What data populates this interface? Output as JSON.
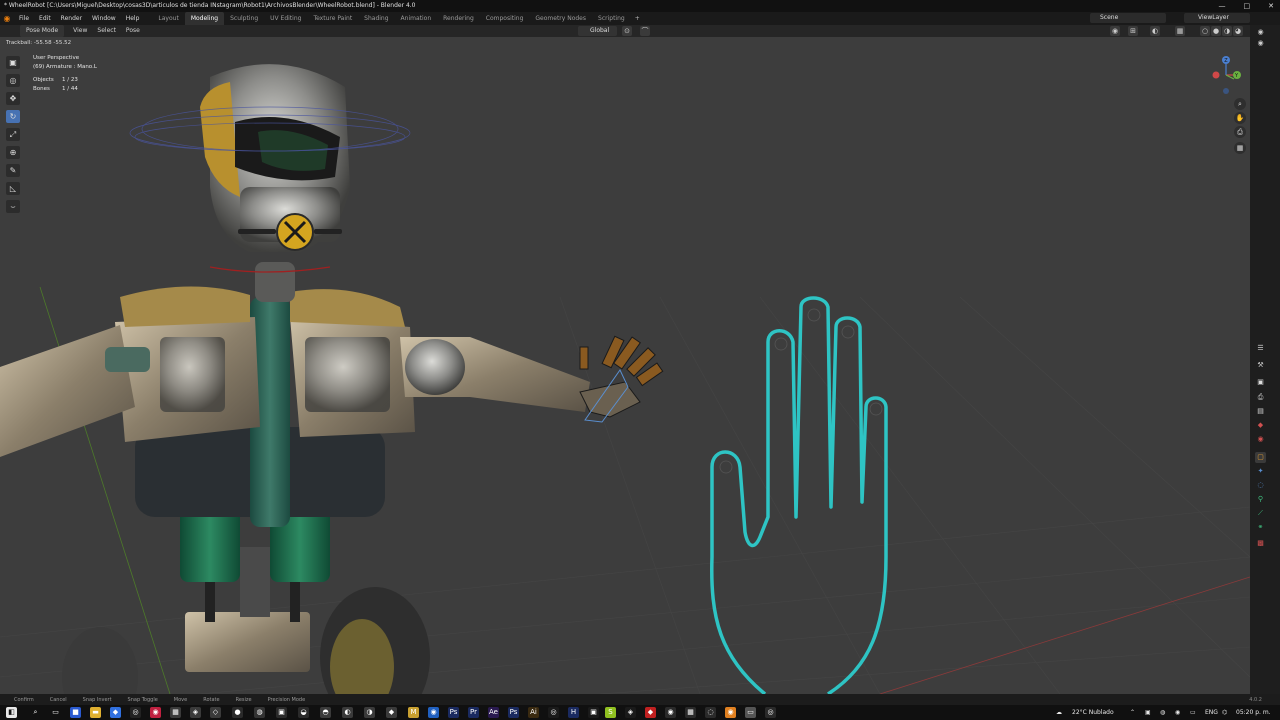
{
  "window": {
    "title": "* WheelRobot [C:\\Users\\Miguel\\Desktop\\cosas3D\\articulos de tienda INstagram\\Robot1\\ArchivosBlender\\WheelRobot.blend] - Blender 4.0",
    "minimize": "—",
    "maximize": "□",
    "close": "✕"
  },
  "menubar": {
    "menus": [
      "File",
      "Edit",
      "Render",
      "Window",
      "Help"
    ],
    "workspaces": [
      "Layout",
      "Modeling",
      "Sculpting",
      "UV Editing",
      "Texture Paint",
      "Shading",
      "Animation",
      "Rendering",
      "Compositing",
      "Geometry Nodes",
      "Scripting"
    ],
    "active_workspace": "Modeling",
    "add_workspace": "+",
    "scene": "Scene",
    "view_layer": "ViewLayer"
  },
  "viewport_header": {
    "mode": "Pose Mode",
    "menus": [
      "View",
      "Select",
      "Pose"
    ],
    "orientation": "Global"
  },
  "overlay": {
    "operator": "Trackball: -55.58 -55.52",
    "view_name": "User Perspective",
    "active_object": "(69) Armature : Mano.L",
    "stats": [
      {
        "label": "Objects",
        "value": "1 / 23"
      },
      {
        "label": "Bones",
        "value": "1 / 44"
      }
    ]
  },
  "tools": [
    {
      "name": "select-box-tool",
      "icon": "▣"
    },
    {
      "name": "cursor-tool",
      "icon": "◎"
    },
    {
      "name": "move-tool",
      "icon": "✥"
    },
    {
      "name": "rotate-tool",
      "icon": "↻",
      "active": true
    },
    {
      "name": "scale-tool",
      "icon": "⤢"
    },
    {
      "name": "transform-tool",
      "icon": "⊕"
    },
    {
      "name": "annotate-tool",
      "icon": "✎"
    },
    {
      "name": "measure-tool",
      "icon": "◺"
    },
    {
      "name": "relax-pose-tool",
      "icon": "⌣"
    }
  ],
  "gizmo": {
    "x_label": "X",
    "y_label": "Y",
    "z_label": "Z"
  },
  "statusbar": {
    "items": [
      "Confirm",
      "Cancel",
      "Snap Invert",
      "Snap Toggle",
      "Move",
      "Rotate",
      "Resize",
      "Precision Mode"
    ],
    "version": "4.0.2"
  },
  "taskbar": {
    "weather": "22°C Nublado",
    "language": "ENG",
    "time": "05:20 p. m."
  },
  "colors": {
    "viewport_bg": "#3d3d3d",
    "hand_outline": "#2ec4c4",
    "active_tool": "#4772b3",
    "blender_orange": "#e87d0d"
  }
}
